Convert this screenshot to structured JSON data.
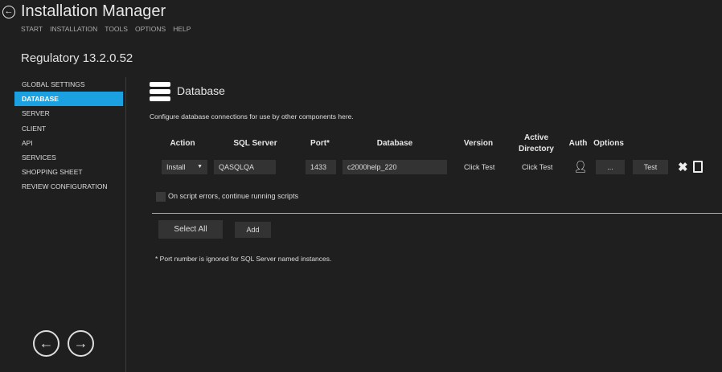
{
  "app": {
    "title": "Installation Manager",
    "menu": [
      "START",
      "INSTALLATION",
      "TOOLS",
      "OPTIONS",
      "HELP"
    ],
    "product": "Regulatory 13.2.0.52"
  },
  "sidebar": {
    "items": [
      "GLOBAL SETTINGS",
      "DATABASE",
      "SERVER",
      "CLIENT",
      "API",
      "SERVICES",
      "SHOPPING SHEET",
      "REVIEW CONFIGURATION"
    ],
    "active": 1
  },
  "main": {
    "title": "Database",
    "description": "Configure database connections for use by other components here.",
    "headers": {
      "action": "Action",
      "sql_server": "SQL Server",
      "port": "Port*",
      "database": "Database",
      "version": "Version",
      "active_directory": "Active Directory",
      "auth": "Auth",
      "options": "Options"
    },
    "row": {
      "action": "Install",
      "sql_server": "QASQLQA",
      "port": "1433",
      "database": "c2000help_220",
      "version": "Click Test",
      "active_directory": "Click Test",
      "options": "...",
      "test": "Test"
    },
    "checkbox_label": "On script errors, continue running scripts",
    "select_all": "Select All",
    "add": "Add",
    "note": "* Port number is ignored for SQL Server named instances."
  },
  "colors": {
    "accent": "#1ba1e2"
  }
}
